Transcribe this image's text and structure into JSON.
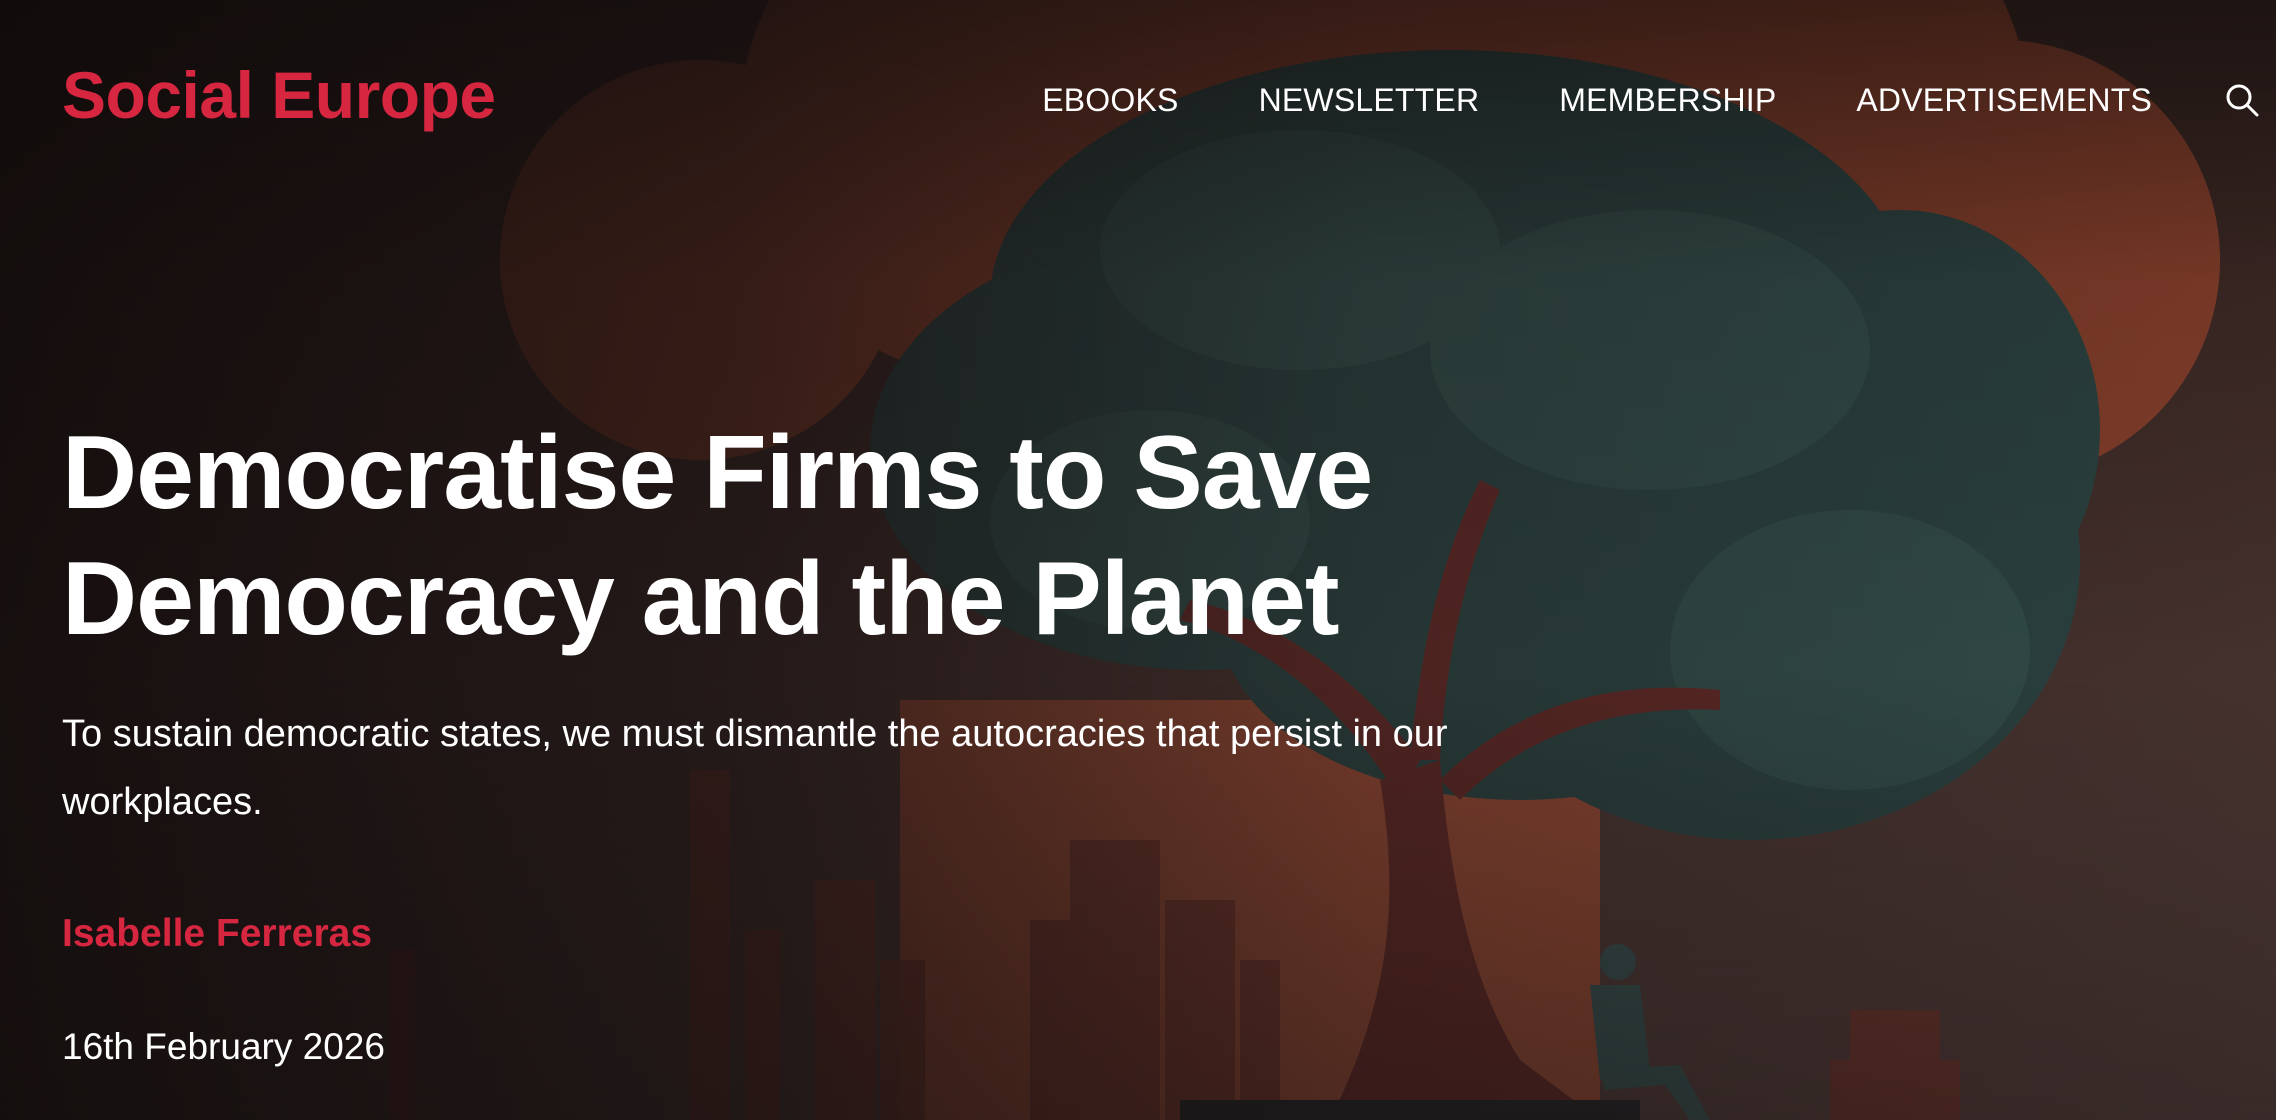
{
  "header": {
    "logo": "Social Europe",
    "nav": [
      "EBOOKS",
      "NEWSLETTER",
      "MEMBERSHIP",
      "ADVERTISEMENTS"
    ],
    "search_icon": "search-icon"
  },
  "article": {
    "title": "Democratise Firms to Save Democracy and the Planet",
    "subtitle": "To sustain democratic states, we must dismantle the autocracies that persist in our workplaces.",
    "author": "Isabelle Ferreras",
    "date": "16th February 2026"
  },
  "colors": {
    "brand": "#d62640",
    "text": "#ffffff"
  }
}
